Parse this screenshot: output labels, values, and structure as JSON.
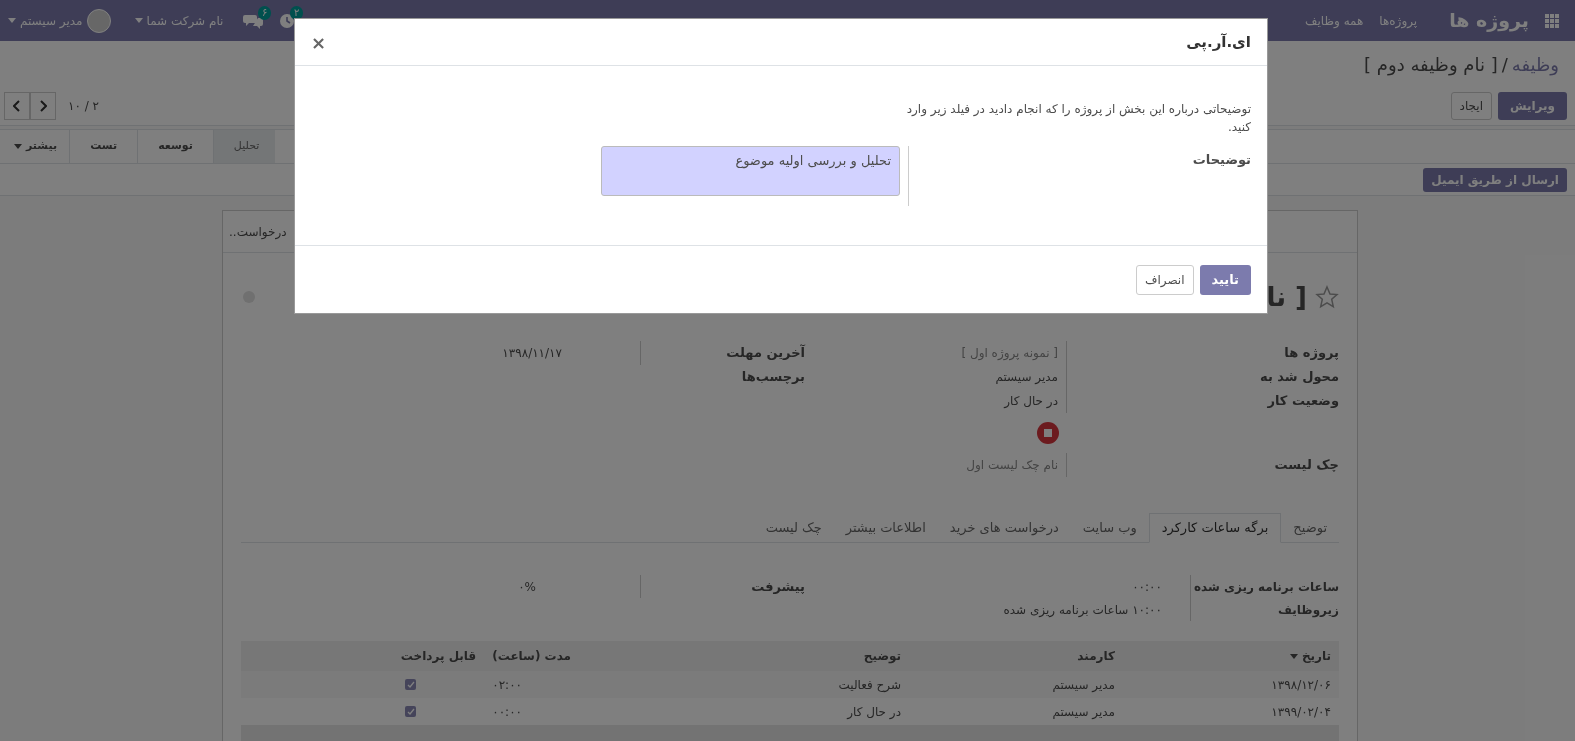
{
  "navbar": {
    "app_title": "پروژه ها",
    "menu": [
      {
        "label": "پروژه‌ها"
      },
      {
        "label": "همه وظایف"
      }
    ],
    "badges": [
      {
        "kind": "activity",
        "count": "۲"
      },
      {
        "kind": "chat",
        "count": "۶"
      }
    ],
    "company": "نام شرکت شما",
    "user": "مدیر سیستم"
  },
  "breadcrumb": {
    "parent": "وظیفه",
    "separator": "/",
    "current": "[ نام وظیفه دوم ]"
  },
  "actions": {
    "edit": "ویرایش",
    "create": "ایجاد"
  },
  "pager": "۲ / ۱۰",
  "stages": [
    {
      "label": "تحلیل",
      "selected": true
    },
    {
      "label": "توسعه",
      "selected": false
    },
    {
      "label": "تست",
      "selected": false
    }
  ],
  "more_stages": "بیشتر",
  "send_email": "ارسال از طریق ایمیل",
  "chatter_hint": "درخواست..",
  "task": {
    "title": "[ نا",
    "starred": false,
    "group_right": [
      {
        "label": "پروژه ها",
        "value": "[ نمونه پروژه اول ]",
        "kind": "link"
      },
      {
        "label": "محول شد به",
        "value": "مدیر سیستم",
        "kind": "text"
      },
      {
        "label": "وضعیت کار",
        "value": "در حال کار",
        "kind": "text"
      },
      {
        "kind": "stop"
      },
      {
        "label": "چک لیست",
        "value": "نام چک لیست اول",
        "kind": "link"
      }
    ],
    "group_left": [
      {
        "label": "آخرین مهلت",
        "value": "۱۳۹۸/۱۱/۱۷"
      },
      {
        "label": "برچسب‌ها"
      }
    ]
  },
  "tabs": [
    {
      "label": "توضیح",
      "selected": false
    },
    {
      "label": "برگه ساعات کارکرد",
      "selected": true
    },
    {
      "label": "وب سایت",
      "selected": false
    },
    {
      "label": "درخواست های خرید",
      "selected": false
    },
    {
      "label": "اطلاعات بیشتر",
      "selected": false
    },
    {
      "label": "چک لیست",
      "selected": false
    }
  ],
  "timesheet": {
    "right": [
      {
        "label": "ساعات برنامه ریزی شده",
        "value": "۰۰:۰۰"
      },
      {
        "label": "زیروظایف",
        "value": "۱۰:۰۰ ساعات برنامه ریزی شده"
      }
    ],
    "left": [
      {
        "label": "پیشرفت",
        "value": "۰%"
      }
    ],
    "columns": [
      "تاریخ",
      "کارمند",
      "توضیح",
      "مدت (ساعت)",
      "قابل پرداخت"
    ],
    "rows": [
      {
        "date": "۱۳۹۸/۱۲/۰۶",
        "employee": "مدیر سیستم",
        "description": "شرح فعالیت",
        "duration": "۰۲:۰۰",
        "billable": true
      },
      {
        "date": "۱۳۹۹/۰۲/۰۴",
        "employee": "مدیر سیستم",
        "description": "در حال کار",
        "duration": "۰۰:۰۰",
        "billable": true
      }
    ]
  },
  "dialog": {
    "title": "ای.آر.پی",
    "close": "×",
    "message": "توضیحاتی درباره این بخش از پروژه را که انجام دادید در فیلد زیر وارد کنید.",
    "field_label": "توضیحات",
    "field_value": "تحلیل و بررسی اولیه موضوع",
    "confirm": "تایید",
    "cancel": "انصراف"
  }
}
